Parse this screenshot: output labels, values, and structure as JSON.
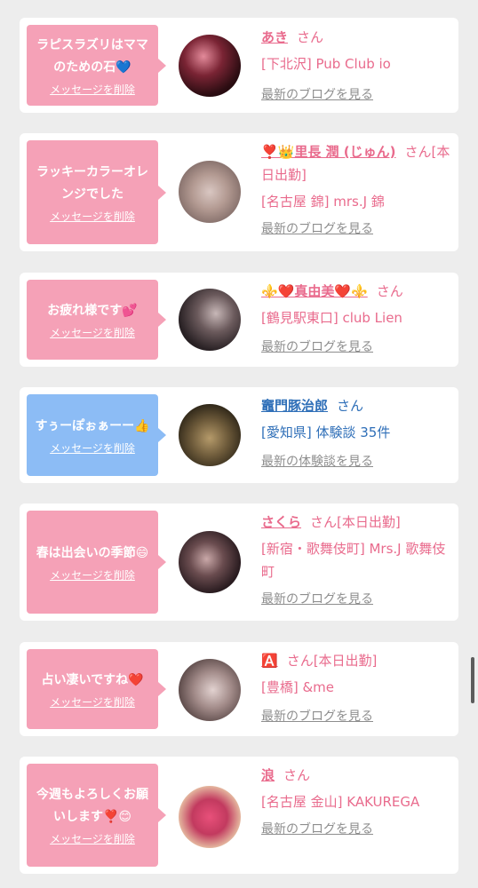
{
  "items": [
    {
      "message": "ラピスラズリはママのための石💙",
      "delete_label": "メッセージを削除",
      "name": "あき",
      "suffix": "さん",
      "location": "[下北沢] Pub Club io",
      "link": "最新のブログを見る",
      "bubble_color": "pink"
    },
    {
      "message": "ラッキーカラーオレンジでした",
      "delete_label": "メッセージを削除",
      "name": "❣️👑里長 潤 (じゅん)",
      "suffix": "さん[本日出勤]",
      "location": "[名古屋 錦] mrs.J 錦",
      "link": "最新のブログを見る",
      "bubble_color": "pink"
    },
    {
      "message": "お疲れ様です💕",
      "delete_label": "メッセージを削除",
      "name": "⚜️❤️真由美❤️⚜️",
      "suffix": "さん",
      "location": "[鶴見駅東口] club Lien",
      "link": "最新のブログを見る",
      "bubble_color": "pink"
    },
    {
      "message": "すぅーぽぉぁーー👍",
      "delete_label": "メッセージを削除",
      "name": "竈門豚治郎",
      "suffix": "さん",
      "location": "[愛知県] 体験談 35件",
      "link": "最新の体験談を見る",
      "bubble_color": "blue"
    },
    {
      "message": "春は出会いの季節😄",
      "delete_label": "メッセージを削除",
      "name": "さくら",
      "suffix": "さん[本日出勤]",
      "location": "[新宿・歌舞伎町] Mrs.J 歌舞伎町",
      "link": "最新のブログを見る",
      "bubble_color": "pink"
    },
    {
      "message": "占い凄いですね❤️",
      "delete_label": "メッセージを削除",
      "name": "🅰️",
      "suffix": "さん[本日出勤]",
      "location": "[豊橋] &me",
      "link": "最新のブログを見る",
      "bubble_color": "pink"
    },
    {
      "message": "今週もよろしくお願いします❣️😊",
      "delete_label": "メッセージを削除",
      "name": "浪",
      "suffix": "さん",
      "location": "[名古屋 金山] KAKUREGA",
      "link": "最新のブログを見る",
      "bubble_color": "pink"
    }
  ]
}
